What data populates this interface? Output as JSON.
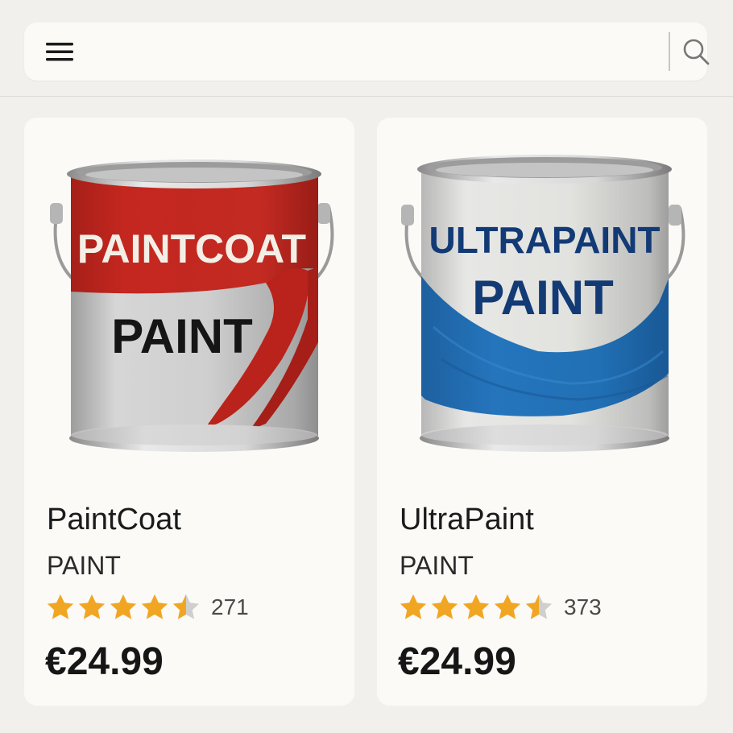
{
  "search": {
    "menu_icon": "hamburger-menu-icon",
    "search_icon": "magnifier-icon",
    "placeholder": "",
    "value": ""
  },
  "products": [
    {
      "name": "PaintCoat",
      "type": "PAINT",
      "rating": 4.5,
      "max_rating": 5,
      "reviews": "271",
      "price": "€24.99",
      "can": {
        "brand_text": "PAINTCOAT",
        "product_text": "PAINT",
        "accent_color": "#c0271f",
        "brand_text_color": "#f4efe6",
        "product_text_color": "#151515"
      }
    },
    {
      "name": "UltraPaint",
      "type": "PAINT",
      "rating": 4.5,
      "max_rating": 5,
      "reviews": "373",
      "price": "€24.99",
      "can": {
        "brand_text": "ULTRAPAINT",
        "product_text": "PAINT",
        "accent_color": "#1f6fb6",
        "brand_text_color": "#123a75",
        "product_text_color": "#123a75"
      }
    }
  ],
  "colors": {
    "star": "#f1a623",
    "star_empty": "#cfcfcf",
    "background": "#f1f0ec",
    "card": "#fbfaf7"
  }
}
